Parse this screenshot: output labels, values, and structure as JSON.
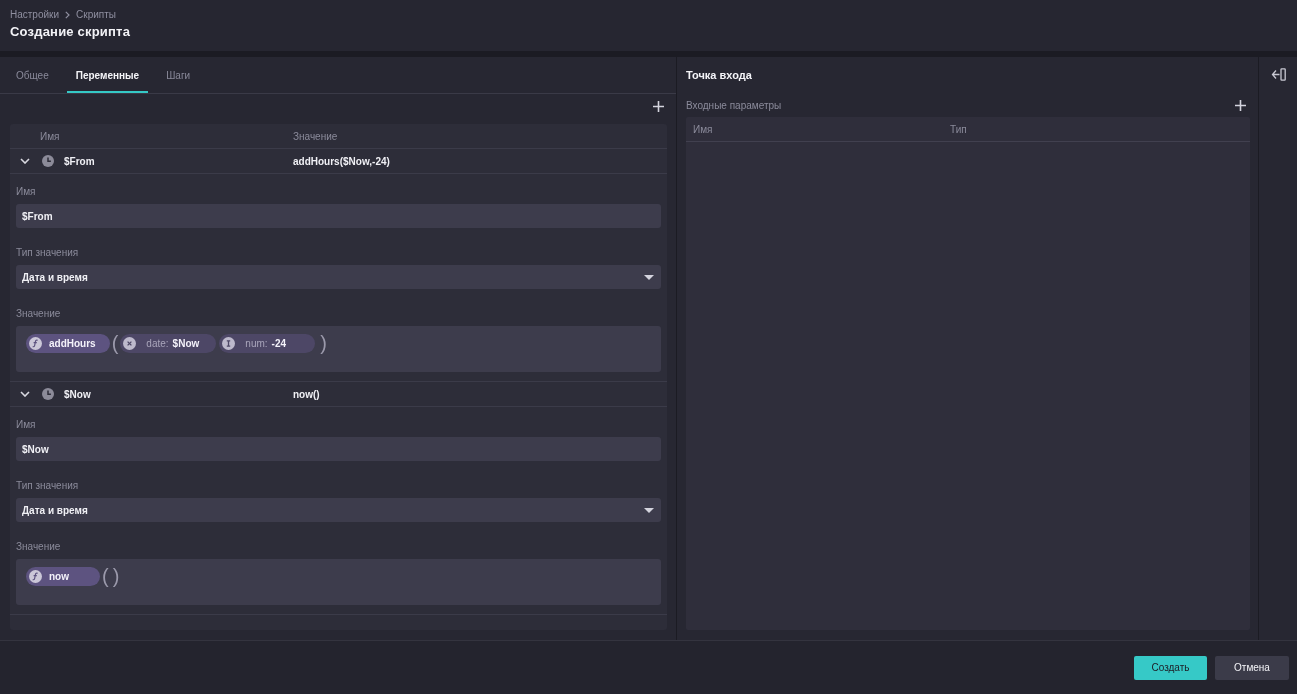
{
  "breadcrumb": [
    "Настройки",
    "Скрипты"
  ],
  "title": "Создание скрипта",
  "tabs": [
    {
      "label": "Общее",
      "selected": false
    },
    {
      "label": "Переменные",
      "selected": true
    },
    {
      "label": "Шаги",
      "selected": false
    }
  ],
  "variables": {
    "columns": [
      "Имя",
      "Значение"
    ],
    "rows": [
      {
        "name": "$From",
        "value": "addHours($Now,-24)",
        "expanded": true,
        "details": {
          "name_label": "Имя",
          "name": "$From",
          "type_label": "Тип значения",
          "type": "Дата и время",
          "value_label": "Значение",
          "expression": {
            "function": "addHours",
            "open_bracket": "(",
            "args": [
              {
                "kind": "date",
                "label": "date:",
                "value": "$Now"
              },
              {
                "kind": "num",
                "label": "num:",
                "value": "-24"
              }
            ],
            "close_bracket": ")"
          }
        }
      },
      {
        "name": "$Now",
        "value": "now()",
        "expanded": true,
        "details": {
          "name_label": "Имя",
          "name": "$Now",
          "type_label": "Тип значения",
          "type": "Дата и время",
          "value_label": "Значение",
          "expression": {
            "function": "now",
            "open_bracket": "(",
            "close_bracket": ")"
          }
        }
      }
    ]
  },
  "entry_point": {
    "title": "Точка входа",
    "params_label": "Входные параметры",
    "columns": [
      "Имя",
      "Тип"
    ]
  },
  "footer": {
    "buttons": [
      {
        "label": "Создать",
        "kind": "primary"
      },
      {
        "label": "Отмена",
        "kind": "secondary"
      }
    ]
  }
}
